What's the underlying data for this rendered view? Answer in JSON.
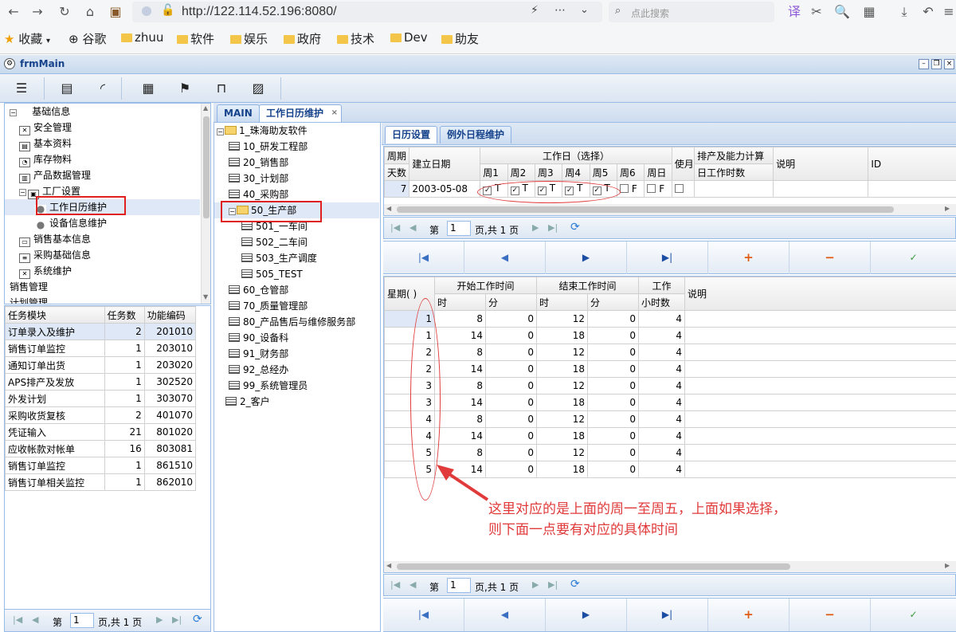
{
  "browser": {
    "url": "http://122.114.52.196:8080/",
    "search_placeholder": "点此搜索",
    "bookmarks": [
      "收藏",
      "谷歌",
      "zhuu",
      "软件",
      "娱乐",
      "政府",
      "技术",
      "Dev",
      "助友"
    ]
  },
  "window": {
    "title": "frmMain"
  },
  "left_tree": [
    {
      "label": "基础信息",
      "level": 0
    },
    {
      "label": "安全管理",
      "level": 1
    },
    {
      "label": "基本资料",
      "level": 1
    },
    {
      "label": "库存物料",
      "level": 1
    },
    {
      "label": "产品数据管理",
      "level": 1
    },
    {
      "label": "工厂设置",
      "level": 1
    },
    {
      "label": "工作日历维护",
      "level": 2
    },
    {
      "label": "设备信息维护",
      "level": 2
    },
    {
      "label": "销售基本信息",
      "level": 1
    },
    {
      "label": "采购基础信息",
      "level": 1
    },
    {
      "label": "系统维护",
      "level": 1
    },
    {
      "label": "销售管理",
      "level": 0
    },
    {
      "label": "计划管理",
      "level": 0
    }
  ],
  "task_grid": {
    "headers": [
      "任务模块",
      "任务数",
      "功能编码"
    ],
    "rows": [
      [
        "订单录入及维护",
        "2",
        "201010"
      ],
      [
        "销售订单监控",
        "1",
        "203010"
      ],
      [
        "通知订单出货",
        "1",
        "203020"
      ],
      [
        "APS排产及发放",
        "1",
        "302520"
      ],
      [
        "外发计划",
        "1",
        "303070"
      ],
      [
        "采购收货复核",
        "2",
        "401070"
      ],
      [
        "凭证输入",
        "21",
        "801020"
      ],
      [
        "应收帐款对帐单",
        "16",
        "803081"
      ],
      [
        "销售订单监控",
        "1",
        "861510"
      ],
      [
        "销售订单相关监控",
        "1",
        "862010"
      ]
    ],
    "pager": {
      "page_label": "第",
      "page": "1",
      "total": "页,共 1 页"
    }
  },
  "main_tabs": [
    "MAIN",
    "工作日历维护"
  ],
  "org_tree": [
    {
      "label": "1_珠海助友软件",
      "level": 0,
      "type": "folder"
    },
    {
      "label": "10_研发工程部",
      "level": 1,
      "type": "list"
    },
    {
      "label": "20_销售部",
      "level": 1,
      "type": "list"
    },
    {
      "label": "30_计划部",
      "level": 1,
      "type": "list"
    },
    {
      "label": "40_采购部",
      "level": 1,
      "type": "list"
    },
    {
      "label": "50_生产部",
      "level": 1,
      "type": "folder"
    },
    {
      "label": "501_一车间",
      "level": 2,
      "type": "list"
    },
    {
      "label": "502_二车间",
      "level": 2,
      "type": "list"
    },
    {
      "label": "503_生产调度",
      "level": 2,
      "type": "list"
    },
    {
      "label": "505_TEST",
      "level": 2,
      "type": "list"
    },
    {
      "label": "60_仓管部",
      "level": 1,
      "type": "list"
    },
    {
      "label": "70_质量管理部",
      "level": 1,
      "type": "list"
    },
    {
      "label": "80_产品售后与维修服务部",
      "level": 1,
      "type": "list"
    },
    {
      "label": "90_设备科",
      "level": 1,
      "type": "list"
    },
    {
      "label": "91_财务部",
      "level": 1,
      "type": "list"
    },
    {
      "label": "92_总经办",
      "level": 1,
      "type": "list"
    },
    {
      "label": "99_系统管理员",
      "level": 1,
      "type": "list"
    },
    {
      "label": "2_客户",
      "level": 0,
      "type": "list"
    }
  ],
  "sub_tabs": [
    "日历设置",
    "例外日程维护"
  ],
  "calendar_grid": {
    "h_weekday_days": "周期天数",
    "h_weekday_a": "周期",
    "h_weekday_b": "天数",
    "h_date": "建立日期",
    "h_workday": "工作日（选择）",
    "weeks": [
      "周1",
      "周2",
      "周3",
      "周4",
      "周5",
      "周6",
      "周日"
    ],
    "h_use": "使月",
    "h_capacity_a": "排产及能力计算",
    "h_capacity_b": "日工作时数",
    "h_note": "说明",
    "h_id": "ID",
    "row": {
      "days": "7",
      "date": "2003-05-08",
      "checks": [
        "T",
        "T",
        "T",
        "T",
        "T",
        "F",
        "F"
      ]
    },
    "pager": {
      "page_label": "第",
      "page": "1",
      "total": "页,共 1 页"
    }
  },
  "time_grid": {
    "h_week": "星期( )",
    "h_start": "开始工作时间",
    "h_end": "结束工作时间",
    "h_work": "工作",
    "h_hour": "时",
    "h_min": "分",
    "h_hours": "小时数",
    "h_note": "说明",
    "rows": [
      [
        "1",
        "8",
        "0",
        "12",
        "0",
        "4"
      ],
      [
        "1",
        "14",
        "0",
        "18",
        "0",
        "4"
      ],
      [
        "2",
        "8",
        "0",
        "12",
        "0",
        "4"
      ],
      [
        "2",
        "14",
        "0",
        "18",
        "0",
        "4"
      ],
      [
        "3",
        "8",
        "0",
        "12",
        "0",
        "4"
      ],
      [
        "3",
        "14",
        "0",
        "18",
        "0",
        "4"
      ],
      [
        "4",
        "8",
        "0",
        "12",
        "0",
        "4"
      ],
      [
        "4",
        "14",
        "0",
        "18",
        "0",
        "4"
      ],
      [
        "5",
        "8",
        "0",
        "12",
        "0",
        "4"
      ],
      [
        "5",
        "14",
        "0",
        "18",
        "0",
        "4"
      ]
    ],
    "pager": {
      "page_label": "第",
      "page": "1",
      "total": "页,共 1 页"
    }
  },
  "annotation": {
    "line1": "这里对应的是上面的周一至周五，上面如果选择，",
    "line2": "则下面一点要有对应的具体时间",
    "color": "#e03a3a"
  }
}
